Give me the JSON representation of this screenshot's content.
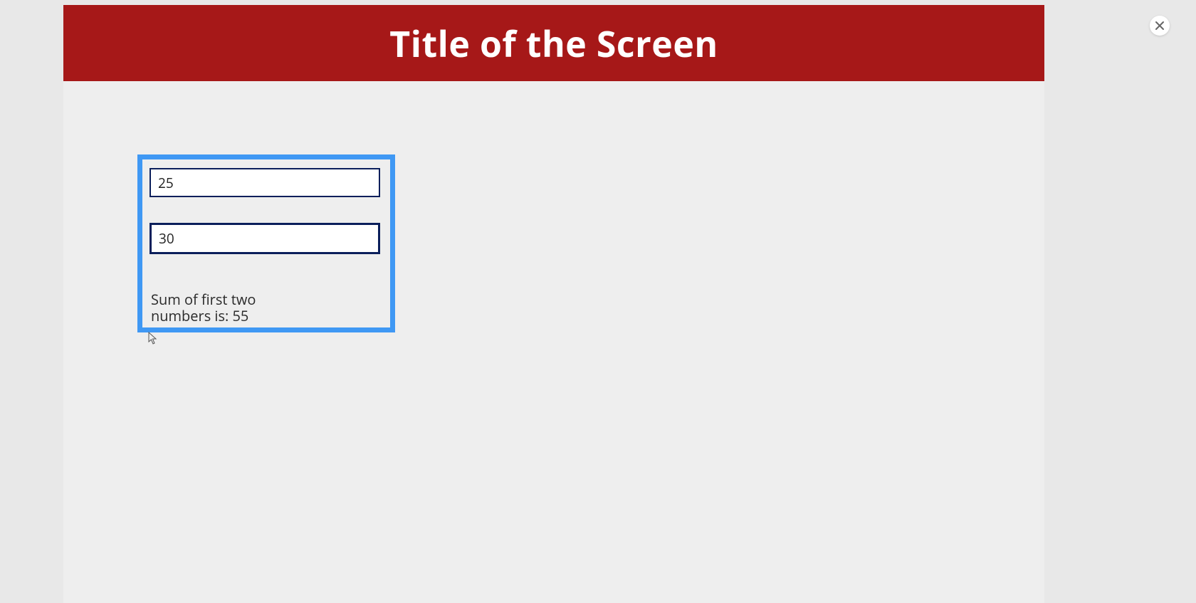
{
  "header": {
    "title": "Title of the Screen"
  },
  "controls": {
    "close_label": "Close"
  },
  "widget": {
    "input1_value": "25",
    "input2_value": "30",
    "result_text": "Sum of first two numbers is: 55"
  },
  "colors": {
    "header_bg": "#a61818",
    "selection_border": "#3f98f4",
    "input_border": "#0b1f5b"
  }
}
